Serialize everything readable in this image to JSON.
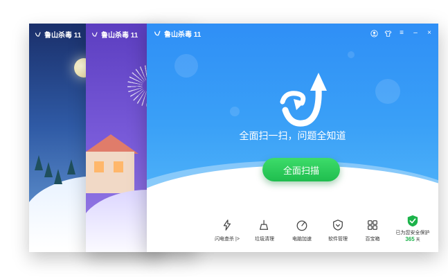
{
  "skins": {
    "night_title": "鲁山杀毒 11",
    "purple_title": "鲁山杀毒 11"
  },
  "window": {
    "title": "鲁山杀毒 11",
    "controls": {
      "avatar": "avatar-icon",
      "skin": "shirt-icon",
      "menu": "≡",
      "minimize": "–",
      "close": "×"
    }
  },
  "hero": {
    "headline": "全面扫一扫，问题全知道",
    "scan_button": "全面扫描",
    "logo_icon": "arrow-loop-icon"
  },
  "tools": [
    {
      "id": "flash",
      "label": "闪电查杀 |>",
      "icon": "lightning-icon"
    },
    {
      "id": "junk",
      "label": "垃圾清理",
      "icon": "broom-icon"
    },
    {
      "id": "speed",
      "label": "电脑加速",
      "icon": "speedometer-icon"
    },
    {
      "id": "soft",
      "label": "软件管理",
      "icon": "shield-box-icon"
    },
    {
      "id": "toolbox",
      "label": "百宝箱",
      "icon": "grid-icon"
    }
  ],
  "protection": {
    "text": "已为您安全保护",
    "days": "365",
    "unit": "天"
  },
  "colors": {
    "hero_blue": "#2f8ff6",
    "scan_green": "#1fbd4e",
    "protect_green": "#1cb34a"
  }
}
